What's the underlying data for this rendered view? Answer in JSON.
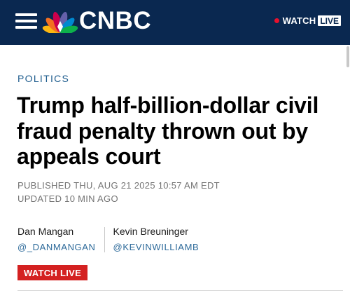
{
  "header": {
    "brand": "CNBC",
    "watch_label": "WATCH",
    "live_badge": "LIVE"
  },
  "article": {
    "section": "POLITICS",
    "headline": "Trump half-billion-dollar civil fraud penalty thrown out by appeals court",
    "published": "PUBLISHED THU, AUG 21 2025 10:57 AM EDT",
    "updated": "UPDATED 10 MIN AGO",
    "authors": [
      {
        "name": "Dan Mangan",
        "handle": "@_DANMANGAN"
      },
      {
        "name": "Kevin Breuninger",
        "handle": "@KEVINWILLIAMB"
      }
    ],
    "watch_live_button": "WATCH LIVE"
  },
  "colors": {
    "header_bg": "#0a2850",
    "live_red": "#e8112d",
    "button_red": "#d42121",
    "link_blue": "#1f5d8e"
  },
  "icons": {
    "menu": "hamburger-menu-icon",
    "logo": "nbc-peacock-icon",
    "live": "live-dot-icon"
  }
}
